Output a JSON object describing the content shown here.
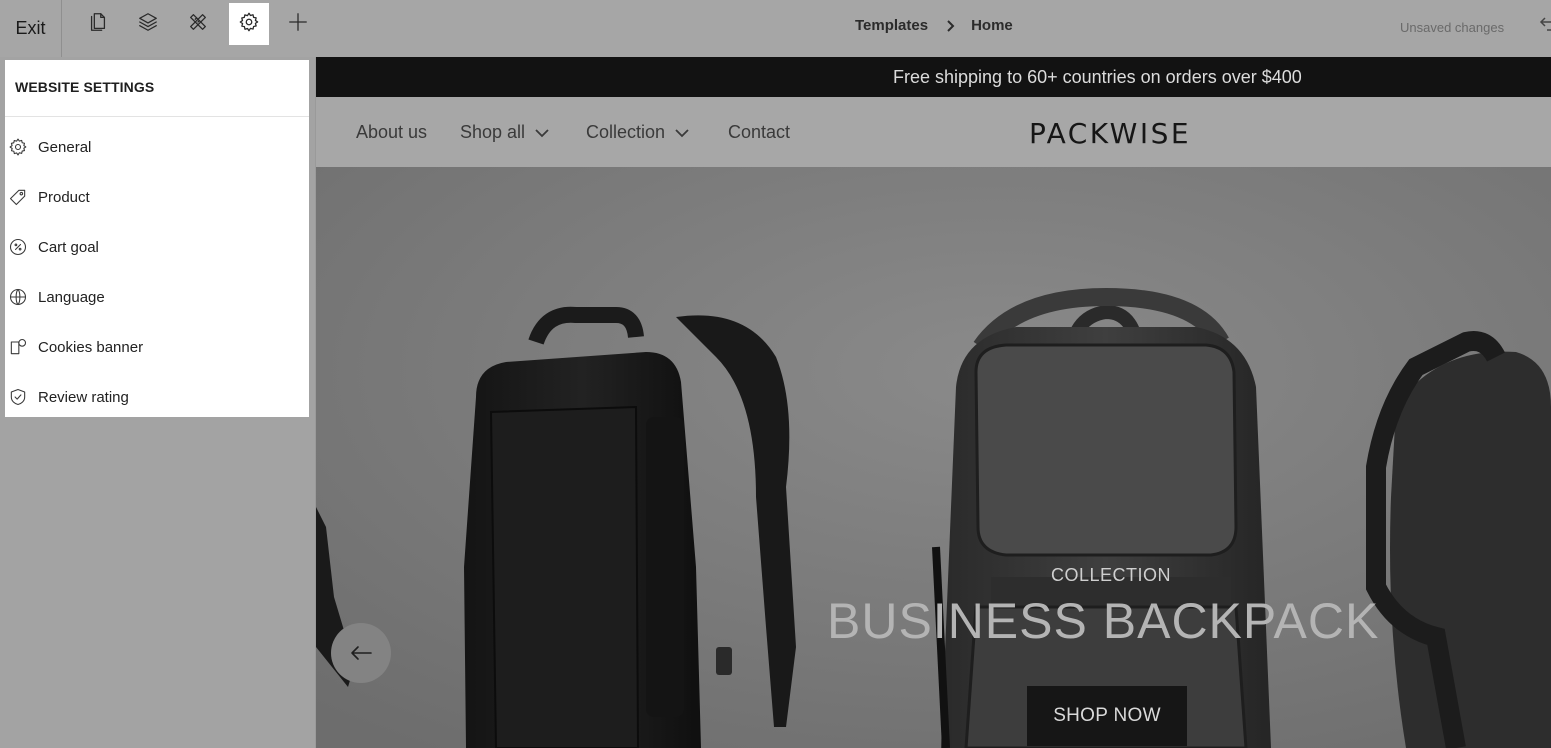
{
  "toolbar": {
    "exit_label": "Exit",
    "tools": [
      {
        "name": "pages-icon",
        "active": false
      },
      {
        "name": "layers-icon",
        "active": false
      },
      {
        "name": "design-tools-icon",
        "active": false
      },
      {
        "name": "gear-icon",
        "active": true
      },
      {
        "name": "plus-icon",
        "active": false
      }
    ],
    "breadcrumb": {
      "parent": "Templates",
      "current": "Home"
    },
    "status": "Unsaved changes"
  },
  "settings_panel": {
    "title": "WEBSITE SETTINGS",
    "items": [
      {
        "label": "General",
        "icon": "gear-icon"
      },
      {
        "label": "Product",
        "icon": "tag-icon"
      },
      {
        "label": "Cart goal",
        "icon": "discount-icon"
      },
      {
        "label": "Language",
        "icon": "globe-icon"
      },
      {
        "label": "Cookies banner",
        "icon": "cookie-icon"
      },
      {
        "label": "Review rating",
        "icon": "shield-check-icon"
      }
    ]
  },
  "site": {
    "announcement": "Free shipping to 60+ countries on orders over $400",
    "nav": [
      {
        "label": "About us",
        "dropdown": false
      },
      {
        "label": "Shop all",
        "dropdown": true
      },
      {
        "label": "Collection",
        "dropdown": true
      },
      {
        "label": "Contact",
        "dropdown": false
      }
    ],
    "logo": "PACKWISE",
    "hero": {
      "subtitle": "COLLECTION",
      "title": "BUSINESS BACKPACK",
      "cta": "SHOP NOW"
    }
  },
  "colors": {
    "overlay_gray": "#a6a6a6",
    "announcement_bg": "#121212",
    "cta_bg": "#161616",
    "panel_bg": "#ffffff"
  }
}
